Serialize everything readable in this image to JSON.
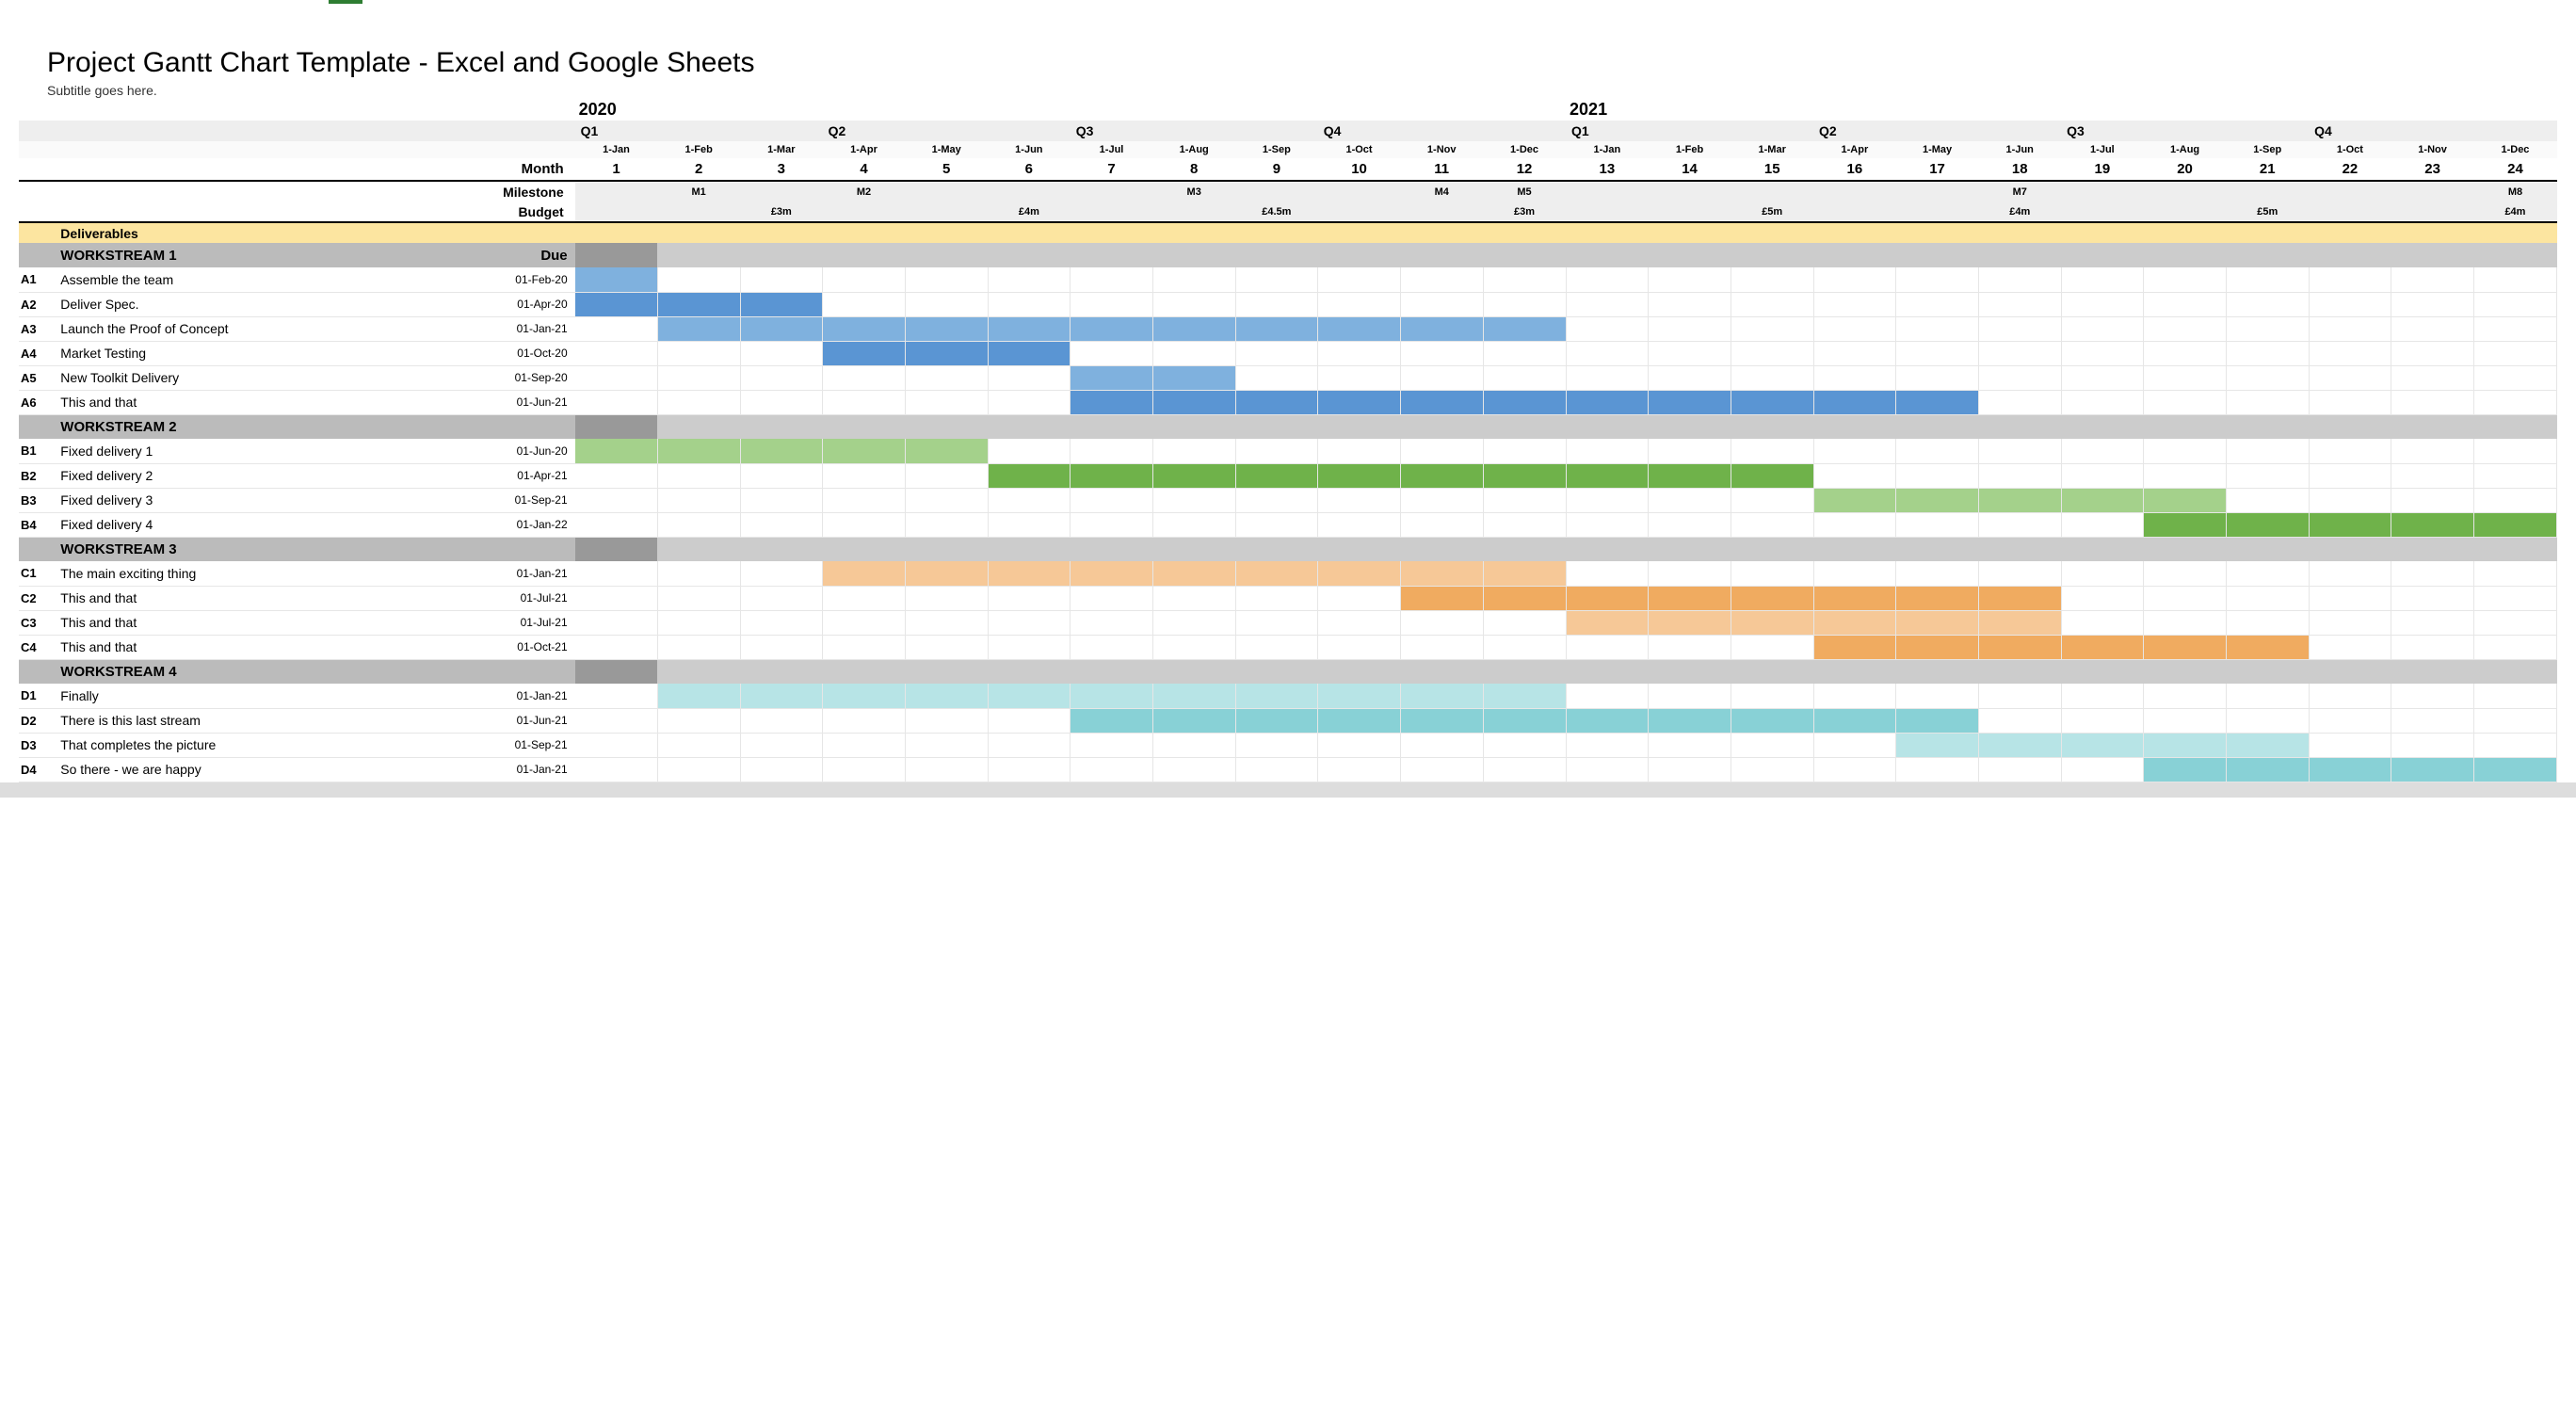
{
  "title": "Project Gantt Chart Template - Excel and Google Sheets",
  "subtitle": "Subtitle goes here.",
  "header_labels": {
    "month": "Month",
    "milestone": "Milestone",
    "budget": "Budget",
    "deliverables": "Deliverables",
    "due": "Due"
  },
  "years": [
    "2020",
    "2021"
  ],
  "quarters": [
    "Q1",
    "Q2",
    "Q3",
    "Q4",
    "Q1",
    "Q2",
    "Q3",
    "Q4"
  ],
  "months": {
    "dates": [
      "1-Jan",
      "1-Feb",
      "1-Mar",
      "1-Apr",
      "1-May",
      "1-Jun",
      "1-Jul",
      "1-Aug",
      "1-Sep",
      "1-Oct",
      "1-Nov",
      "1-Dec",
      "1-Jan",
      "1-Feb",
      "1-Mar",
      "1-Apr",
      "1-May",
      "1-Jun",
      "1-Jul",
      "1-Aug",
      "1-Sep",
      "1-Oct",
      "1-Nov",
      "1-Dec"
    ],
    "nums": [
      "1",
      "2",
      "3",
      "4",
      "5",
      "6",
      "7",
      "8",
      "9",
      "10",
      "11",
      "12",
      "13",
      "14",
      "15",
      "16",
      "17",
      "18",
      "19",
      "20",
      "21",
      "22",
      "23",
      "24"
    ]
  },
  "milestones": {
    "2": "M1",
    "4": "M2",
    "8": "M3",
    "11": "M4",
    "12": "M5",
    "18": "M7",
    "24": "M8"
  },
  "budget": {
    "3": "£3m",
    "6": "£4m",
    "9": "£4.5m",
    "12": "£3m",
    "15": "£5m",
    "18": "£4m",
    "21": "£5m",
    "24": "£4m"
  },
  "workstreams": [
    {
      "name": "WORKSTREAM 1",
      "due_header": "Due",
      "tasks": [
        {
          "id": "A1",
          "name": "Assemble the team",
          "due": "01-Feb-20",
          "start": 1,
          "end": 1,
          "color": "blue1"
        },
        {
          "id": "A2",
          "name": "Deliver Spec.",
          "due": "01-Apr-20",
          "start": 1,
          "end": 3,
          "color": "blue2"
        },
        {
          "id": "A3",
          "name": "Launch the Proof of Concept",
          "due": "01-Jan-21",
          "start": 2,
          "end": 12,
          "color": "blue1"
        },
        {
          "id": "A4",
          "name": "Market Testing",
          "due": "01-Oct-20",
          "start": 4,
          "end": 6,
          "color": "blue2"
        },
        {
          "id": "A5",
          "name": "New Toolkit Delivery",
          "due": "01-Sep-20",
          "start": 7,
          "end": 8,
          "color": "blue1"
        },
        {
          "id": "A6",
          "name": "This and that",
          "due": "01-Jun-21",
          "start": 7,
          "end": 17,
          "color": "blue2"
        }
      ]
    },
    {
      "name": "WORKSTREAM 2",
      "tasks": [
        {
          "id": "B1",
          "name": "Fixed delivery 1",
          "due": "01-Jun-20",
          "start": 1,
          "end": 5,
          "color": "green1"
        },
        {
          "id": "B2",
          "name": "Fixed delivery 2",
          "due": "01-Apr-21",
          "start": 6,
          "end": 15,
          "color": "green2"
        },
        {
          "id": "B3",
          "name": "Fixed delivery 3",
          "due": "01-Sep-21",
          "start": 16,
          "end": 20,
          "color": "green1"
        },
        {
          "id": "B4",
          "name": "Fixed delivery 4",
          "due": "01-Jan-22",
          "start": 20,
          "end": 24,
          "color": "green2"
        }
      ]
    },
    {
      "name": "WORKSTREAM 3",
      "tasks": [
        {
          "id": "C1",
          "name": "The main exciting thing",
          "due": "01-Jan-21",
          "start": 4,
          "end": 12,
          "color": "orange1"
        },
        {
          "id": "C2",
          "name": "This and that",
          "due": "01-Jul-21",
          "start": 11,
          "end": 18,
          "color": "orange2"
        },
        {
          "id": "C3",
          "name": "This and that",
          "due": "01-Jul-21",
          "start": 13,
          "end": 18,
          "color": "orange1"
        },
        {
          "id": "C4",
          "name": "This and that",
          "due": "01-Oct-21",
          "start": 16,
          "end": 21,
          "color": "orange2"
        }
      ]
    },
    {
      "name": "WORKSTREAM 4",
      "tasks": [
        {
          "id": "D1",
          "name": "Finally",
          "due": "01-Jan-21",
          "start": 2,
          "end": 12,
          "color": "teal1"
        },
        {
          "id": "D2",
          "name": "There is this last stream",
          "due": "01-Jun-21",
          "start": 7,
          "end": 17,
          "color": "teal2"
        },
        {
          "id": "D3",
          "name": "That completes the picture",
          "due": "01-Sep-21",
          "start": 17,
          "end": 21,
          "color": "teal1"
        },
        {
          "id": "D4",
          "name": "So there - we are happy",
          "due": "01-Jan-21",
          "start": 20,
          "end": 24,
          "color": "teal2"
        }
      ]
    }
  ],
  "chart_data": {
    "type": "table",
    "title": "Project Gantt Chart Template - Excel and Google Sheets",
    "subtitle": "Subtitle goes here.",
    "x_months": [
      "2020-01",
      "2020-02",
      "2020-03",
      "2020-04",
      "2020-05",
      "2020-06",
      "2020-07",
      "2020-08",
      "2020-09",
      "2020-10",
      "2020-11",
      "2020-12",
      "2021-01",
      "2021-02",
      "2021-03",
      "2021-04",
      "2021-05",
      "2021-06",
      "2021-07",
      "2021-08",
      "2021-09",
      "2021-10",
      "2021-11",
      "2021-12"
    ],
    "milestones": [
      {
        "month": 2,
        "label": "M1"
      },
      {
        "month": 4,
        "label": "M2"
      },
      {
        "month": 8,
        "label": "M3"
      },
      {
        "month": 11,
        "label": "M4"
      },
      {
        "month": 12,
        "label": "M5"
      },
      {
        "month": 18,
        "label": "M7"
      },
      {
        "month": 24,
        "label": "M8"
      }
    ],
    "budget": [
      {
        "month": 3,
        "value": "£3m"
      },
      {
        "month": 6,
        "value": "£4m"
      },
      {
        "month": 9,
        "value": "£4.5m"
      },
      {
        "month": 12,
        "value": "£3m"
      },
      {
        "month": 15,
        "value": "£5m"
      },
      {
        "month": 18,
        "value": "£4m"
      },
      {
        "month": 21,
        "value": "£5m"
      },
      {
        "month": 24,
        "value": "£4m"
      }
    ],
    "series": [
      {
        "group": "WORKSTREAM 1",
        "id": "A1",
        "name": "Assemble the team",
        "due": "01-Feb-20",
        "start": 1,
        "end": 1
      },
      {
        "group": "WORKSTREAM 1",
        "id": "A2",
        "name": "Deliver Spec.",
        "due": "01-Apr-20",
        "start": 1,
        "end": 3
      },
      {
        "group": "WORKSTREAM 1",
        "id": "A3",
        "name": "Launch the Proof of Concept",
        "due": "01-Jan-21",
        "start": 2,
        "end": 12
      },
      {
        "group": "WORKSTREAM 1",
        "id": "A4",
        "name": "Market Testing",
        "due": "01-Oct-20",
        "start": 4,
        "end": 6
      },
      {
        "group": "WORKSTREAM 1",
        "id": "A5",
        "name": "New Toolkit Delivery",
        "due": "01-Sep-20",
        "start": 7,
        "end": 8
      },
      {
        "group": "WORKSTREAM 1",
        "id": "A6",
        "name": "This and that",
        "due": "01-Jun-21",
        "start": 7,
        "end": 17
      },
      {
        "group": "WORKSTREAM 2",
        "id": "B1",
        "name": "Fixed delivery 1",
        "due": "01-Jun-20",
        "start": 1,
        "end": 5
      },
      {
        "group": "WORKSTREAM 2",
        "id": "B2",
        "name": "Fixed delivery 2",
        "due": "01-Apr-21",
        "start": 6,
        "end": 15
      },
      {
        "group": "WORKSTREAM 2",
        "id": "B3",
        "name": "Fixed delivery 3",
        "due": "01-Sep-21",
        "start": 16,
        "end": 20
      },
      {
        "group": "WORKSTREAM 2",
        "id": "B4",
        "name": "Fixed delivery 4",
        "due": "01-Jan-22",
        "start": 20,
        "end": 24
      },
      {
        "group": "WORKSTREAM 3",
        "id": "C1",
        "name": "The main exciting thing",
        "due": "01-Jan-21",
        "start": 4,
        "end": 12
      },
      {
        "group": "WORKSTREAM 3",
        "id": "C2",
        "name": "This and that",
        "due": "01-Jul-21",
        "start": 11,
        "end": 18
      },
      {
        "group": "WORKSTREAM 3",
        "id": "C3",
        "name": "This and that",
        "due": "01-Jul-21",
        "start": 13,
        "end": 18
      },
      {
        "group": "WORKSTREAM 3",
        "id": "C4",
        "name": "This and that",
        "due": "01-Oct-21",
        "start": 16,
        "end": 21
      },
      {
        "group": "WORKSTREAM 4",
        "id": "D1",
        "name": "Finally",
        "due": "01-Jan-21",
        "start": 2,
        "end": 12
      },
      {
        "group": "WORKSTREAM 4",
        "id": "D2",
        "name": "There is this last stream",
        "due": "01-Jun-21",
        "start": 7,
        "end": 17
      },
      {
        "group": "WORKSTREAM 4",
        "id": "D3",
        "name": "That completes the picture",
        "due": "01-Sep-21",
        "start": 17,
        "end": 21
      },
      {
        "group": "WORKSTREAM 4",
        "id": "D4",
        "name": "So there - we are happy",
        "due": "01-Jan-21",
        "start": 20,
        "end": 24
      }
    ]
  }
}
